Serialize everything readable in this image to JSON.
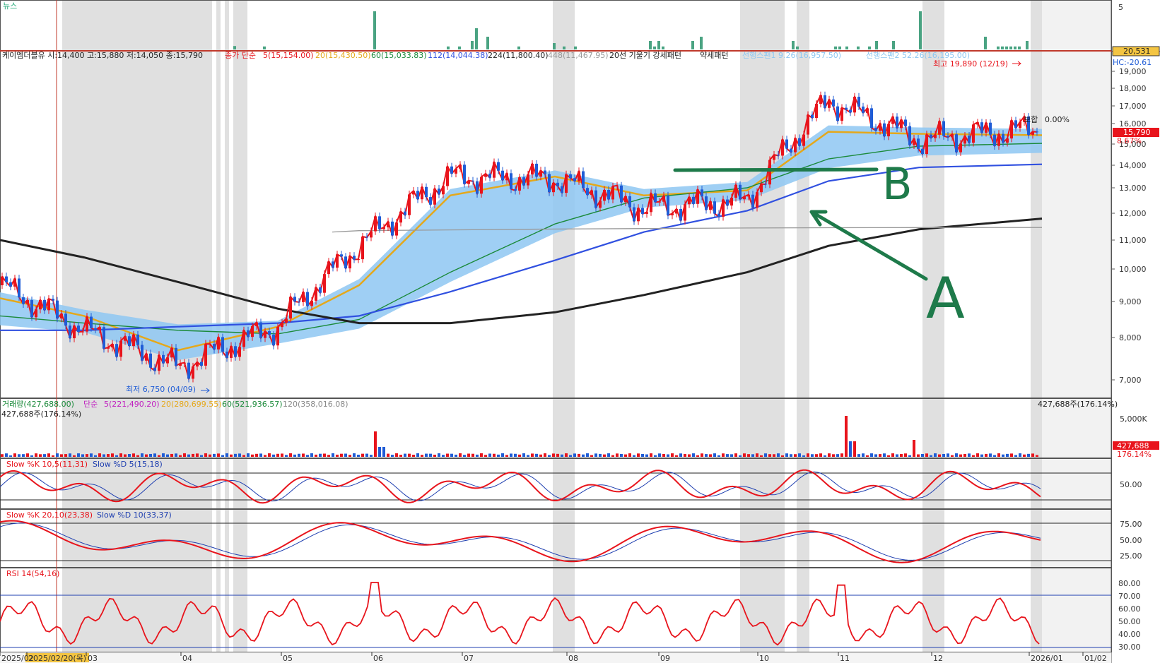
{
  "news_panel": {
    "label": "뉴스",
    "tick_right": "5",
    "spikes": [
      0.08,
      0.07,
      0.9,
      0.07,
      0.07,
      0.2,
      0.5,
      0.3,
      0.07,
      0.15,
      0.07,
      0.07,
      0.2,
      0.07,
      0.2,
      0.07,
      0.2,
      0.3,
      0.2,
      0.07,
      0.07,
      0.07,
      0.07,
      0.07,
      0.07,
      0.2,
      0.2,
      0.9,
      0.3,
      0.07,
      0.07,
      0.07,
      0.07,
      0.07,
      0.07,
      0.2,
      0.5,
      0.08,
      0.07,
      0.07,
      0.07,
      0.07,
      0.07,
      0.07,
      0.07,
      0.07,
      0.2,
      0.07,
      0.07,
      0.07,
      0.07,
      0.07,
      0.07,
      0.07,
      0.07,
      0.07,
      0.07,
      0.07,
      0.07,
      0.07,
      0.07,
      0.07,
      0.07,
      0.07,
      0.07,
      0.07,
      0.07,
      0.07,
      0.07,
      0.07,
      0.07,
      0.07,
      0.07,
      0.07,
      0.07,
      0.07,
      0.07,
      0.07,
      0.07,
      0.07,
      0.07,
      0.07,
      0.07,
      0.07,
      0.07,
      0.07,
      0.07,
      0.07,
      0.07,
      0.07,
      0.07,
      0.07,
      0.07,
      0.07,
      0.07,
      0.07,
      0.07,
      0.07,
      0.07,
      0.07,
      0.07,
      0.07,
      0.07,
      0.07,
      0.07,
      0.07,
      0.07,
      0.07,
      0.07,
      0.07,
      0.07,
      0.07,
      0.07,
      0.07,
      0.07,
      0.07,
      0.07,
      0.07,
      0.07,
      0.07,
      0.07,
      0.07,
      0.07,
      0.07,
      0.07,
      0.07,
      0.07,
      0.07,
      0.07,
      0.07,
      0.07,
      0.07,
      0.07,
      0.07,
      0.07,
      0.07,
      0.07,
      0.07,
      0.07,
      0.07,
      0.07,
      0.07,
      0.07,
      0.07,
      0.07,
      0.07,
      0.07,
      0.07,
      0.07,
      0.07,
      0.07,
      0.07,
      0.07,
      0.07,
      0.07,
      0.07,
      0.07,
      0.07,
      0.07,
      0.07,
      0.07,
      0.07,
      0.07,
      0.07,
      0.07,
      0.07,
      0.07,
      0.07,
      0.07,
      0.07,
      0.07,
      0.07,
      0.07,
      0.07,
      0.07,
      0.07,
      0.07,
      0.07,
      0.07,
      0.07,
      0.07,
      0.07,
      0.07,
      0.07,
      0.07,
      0.07,
      0.07,
      0.07,
      0.07,
      0.07,
      0.07,
      0.07,
      0.07,
      0.07,
      0.07,
      0.07,
      0.07,
      0.07,
      0.07,
      0.07,
      0.07,
      0.07,
      0.07,
      0.07,
      0.07,
      0.07,
      0.07,
      0.07,
      0.07,
      0.07,
      0.07,
      0.07,
      0.07,
      0.07,
      0.07,
      0.07,
      0.07,
      0.07,
      0.07,
      0.07,
      0.07,
      0.07,
      0.07,
      0.07,
      0.07,
      0.07,
      0.07,
      0.07,
      0.07,
      0.07,
      0.07,
      0.07,
      0.07,
      0.07,
      0.07,
      0.07,
      0.07,
      0.07,
      0.07,
      0.07,
      0.07,
      0.07,
      0.07,
      0.07,
      0.07,
      0.07,
      0.07,
      0.07,
      0.07,
      0.07,
      0.07,
      0.07,
      0.07,
      0.07,
      0.07,
      0.07,
      0.07,
      0.07,
      0.07,
      0.07,
      0.07,
      0.07,
      0.07,
      0.07,
      0.07,
      0.07,
      0.07,
      0.07,
      0.07,
      0.07,
      0.07,
      0.07,
      0.07,
      0.07,
      0.07,
      0.07,
      0.07,
      0.07,
      0.07,
      0.07,
      0.07,
      0.07,
      0.07,
      0.07,
      0.07,
      0.07,
      0.07,
      0.07,
      0.07,
      0.07,
      0.07,
      0.07,
      0.07,
      0.07,
      0.07,
      0.07,
      0.07,
      0.07,
      0.07,
      0.07,
      0.07,
      0.07,
      0.07,
      0.07,
      0.07,
      0.07,
      0.07,
      0.07,
      0.07,
      0.07,
      0.07,
      0.07,
      0.07,
      0.07,
      0.07
    ]
  },
  "header": {
    "stock": "케이엠더블유 시:14,400 고:15,880 저:14,050 종:15,790",
    "ma_title": "종가 단순",
    "ma5": "5(15,154.00)",
    "ma20": "20(15,430.50)",
    "ma60": "60(15,033.83)",
    "ma112": "112(14,044.38)",
    "ma224": "224(11,800.40)",
    "ma448": "448(11,467.95)",
    "pattern": "20선 기울기 강세패턴",
    "weak": "약세패턴",
    "span1": "선행스팬1 9.26(16,957.50)",
    "span2": "선행스팬2 52.26(16,195.00)"
  },
  "price_axis": {
    "ticks": [
      "19,000",
      "18,000",
      "17,000",
      "16,000",
      "15,000",
      "14,000",
      "13,000",
      "12,000",
      "11,000",
      "10,000",
      "9,000",
      "8,000",
      "7,000"
    ],
    "hc": "HC:-20.61",
    "top_box": "20,531",
    "current_box": "15,790",
    "pct": "8.67%"
  },
  "annotations": {
    "high": "최고 19,890 (12/19)",
    "low": "최저 6,750 (04/09)",
    "flat": "0.00%",
    "flat_prefix": "보합",
    "label_a": "A",
    "label_b": "B"
  },
  "volume_panel": {
    "title_prefix": "거래량(427,688.00)",
    "ma_title": "단순",
    "v5": "5(221,490.20)",
    "v20": "20(280,699.55)",
    "v60": "60(521,936.57)",
    "v120": "120(358,016.08)",
    "left_value": "427,688주(176.14%)",
    "right_value": "427,688주(176.14%)",
    "tick": "5,000K",
    "box_value": "427,688",
    "box_pct": "176.14%"
  },
  "stoch1": {
    "k": "Slow %K 10,5(11,31)",
    "d": "Slow %D 5(15,18)",
    "tick": "50.00"
  },
  "stoch2": {
    "k": "Slow %K 20,10(23,38)",
    "d": "Slow %D 10(33,37)",
    "ticks": [
      "75.00",
      "50.00",
      "25.00"
    ]
  },
  "rsi": {
    "label": "RSI 14(54,16)",
    "ticks": [
      "80.00",
      "70.00",
      "60.00",
      "50.00",
      "40.00",
      "30.00"
    ]
  },
  "x_axis": {
    "labels": [
      "2025/02",
      "2025/02/20(목)",
      "03",
      "04",
      "05",
      "06",
      "07",
      "08",
      "09",
      "10",
      "11",
      "12",
      "2026/01",
      "01/02"
    ]
  },
  "colors": {
    "up": "#e8141c",
    "down": "#1f5cd6",
    "ma5": "#e8141c",
    "ma20": "#e5a81a",
    "ma60": "#1b8a3a",
    "ma112": "#3050e0",
    "ma224": "#222222",
    "ma448": "#999999",
    "cloud": "#8ec7f2",
    "shade": "#e0e0e0",
    "news": "#4aa382",
    "marker": "#1e7a4a"
  },
  "chart_data": {
    "type": "line",
    "title": "케이엠더블유",
    "xlabel": "",
    "ylabel": "",
    "ylim": [
      6700,
      20000
    ],
    "categories": [
      "2025/02",
      "03",
      "04",
      "05",
      "06",
      "07",
      "08",
      "09",
      "10",
      "11",
      "12",
      "2026/01"
    ],
    "series": [
      {
        "name": "종가",
        "values": [
          9500,
          8200,
          7300,
          8300,
          10800,
          13500,
          13400,
          12200,
          12500,
          17300,
          15200,
          15790
        ]
      },
      {
        "name": "20",
        "values": [
          9100,
          8600,
          7700,
          8300,
          9500,
          12700,
          13500,
          12700,
          12900,
          15600,
          15500,
          15430
        ]
      },
      {
        "name": "60",
        "values": [
          8600,
          8400,
          8200,
          8100,
          8500,
          9900,
          11600,
          12600,
          13000,
          14300,
          14900,
          15034
        ]
      },
      {
        "name": "112",
        "values": [
          8200,
          8200,
          8300,
          8400,
          8600,
          9300,
          10300,
          11300,
          12100,
          13300,
          13900,
          14044
        ]
      },
      {
        "name": "224",
        "values": [
          11000,
          10400,
          9600,
          8800,
          8400,
          8400,
          8700,
          9200,
          9900,
          10800,
          11400,
          11800
        ]
      },
      {
        "name": "448",
        "values": [
          11200,
          11200,
          11250,
          11300,
          11350,
          11380,
          11410,
          11430,
          11450,
          11460,
          11465,
          11468
        ]
      }
    ],
    "high": 19890,
    "low": 6750,
    "current": 15790,
    "resistance_line": 14000
  }
}
